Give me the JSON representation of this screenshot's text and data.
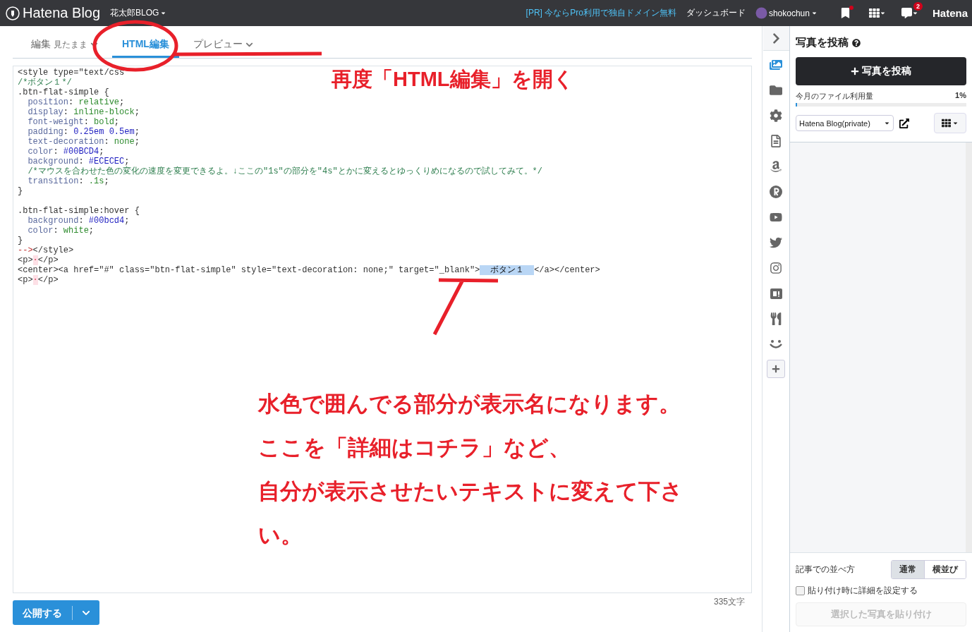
{
  "header": {
    "logo": "Hatena Blog",
    "blog_name": "花太郎BLOG",
    "promo": "[PR] 今ならPro利用で独自ドメイン無料",
    "dashboard": "ダッシュボード",
    "user": "shokochun",
    "notification_count": "2",
    "brand": "Hatena"
  },
  "editor_tabs": [
    {
      "label": "編集",
      "sublabel": "見たまま",
      "selected": false,
      "has_menu": true
    },
    {
      "label": "HTML編集",
      "selected": true,
      "has_menu": false
    },
    {
      "label": "プレビュー",
      "selected": false,
      "has_menu": true
    }
  ],
  "code_lines": [
    {
      "segments": [
        {
          "kind": "tag",
          "text": "<style type=\"text/css"
        }
      ]
    },
    {
      "segments": [
        {
          "kind": "comment",
          "text": "/*ボタン１*/"
        }
      ]
    },
    {
      "segments": [
        {
          "kind": "plain",
          "text": ".btn-flat-simple {"
        }
      ]
    },
    {
      "segments": [
        {
          "kind": "prop",
          "text": "  position"
        },
        {
          "kind": "plain",
          "text": ": "
        },
        {
          "kind": "value",
          "text": "relative"
        },
        {
          "kind": "plain",
          "text": ";"
        }
      ]
    },
    {
      "segments": [
        {
          "kind": "prop",
          "text": "  display"
        },
        {
          "kind": "plain",
          "text": ": "
        },
        {
          "kind": "value",
          "text": "inline-block"
        },
        {
          "kind": "plain",
          "text": ";"
        }
      ]
    },
    {
      "segments": [
        {
          "kind": "prop",
          "text": "  font-weight"
        },
        {
          "kind": "plain",
          "text": ": "
        },
        {
          "kind": "value",
          "text": "bold"
        },
        {
          "kind": "plain",
          "text": ";"
        }
      ]
    },
    {
      "segments": [
        {
          "kind": "prop",
          "text": "  padding"
        },
        {
          "kind": "plain",
          "text": ": "
        },
        {
          "kind": "number",
          "text": "0.25em 0.5em"
        },
        {
          "kind": "plain",
          "text": ";"
        }
      ]
    },
    {
      "segments": [
        {
          "kind": "prop",
          "text": "  text-decoration"
        },
        {
          "kind": "plain",
          "text": ": "
        },
        {
          "kind": "value",
          "text": "none"
        },
        {
          "kind": "plain",
          "text": ";"
        }
      ]
    },
    {
      "segments": [
        {
          "kind": "prop",
          "text": "  color"
        },
        {
          "kind": "plain",
          "text": ": "
        },
        {
          "kind": "number",
          "text": "#00BCD4"
        },
        {
          "kind": "plain",
          "text": ";"
        }
      ]
    },
    {
      "segments": [
        {
          "kind": "prop",
          "text": "  background"
        },
        {
          "kind": "plain",
          "text": ": "
        },
        {
          "kind": "number",
          "text": "#ECECEC"
        },
        {
          "kind": "plain",
          "text": ";"
        }
      ]
    },
    {
      "segments": [
        {
          "kind": "comment",
          "text": "  /*マウスを合わせた色の変化の速度を変更できるよ。↓ここの\"1s\"の部分を\"4s\"とかに変えるとゆっくりめになるので試してみて。*/"
        }
      ]
    },
    {
      "segments": [
        {
          "kind": "prop",
          "text": "  transition"
        },
        {
          "kind": "plain",
          "text": ": "
        },
        {
          "kind": "value",
          "text": ".1s"
        },
        {
          "kind": "plain",
          "text": ";"
        }
      ]
    },
    {
      "segments": [
        {
          "kind": "plain",
          "text": "}"
        }
      ]
    },
    {
      "kind": "blank"
    },
    {
      "segments": [
        {
          "kind": "plain",
          "text": ".btn-flat-simple:hover {"
        }
      ]
    },
    {
      "segments": [
        {
          "kind": "prop",
          "text": "  background"
        },
        {
          "kind": "plain",
          "text": ": "
        },
        {
          "kind": "number",
          "text": "#00bcd4"
        },
        {
          "kind": "plain",
          "text": ";"
        }
      ]
    },
    {
      "segments": [
        {
          "kind": "prop",
          "text": "  color"
        },
        {
          "kind": "plain",
          "text": ": "
        },
        {
          "kind": "value",
          "text": "white"
        },
        {
          "kind": "plain",
          "text": ";"
        }
      ]
    },
    {
      "segments": [
        {
          "kind": "plain",
          "text": "}"
        }
      ]
    },
    {
      "segments": [
        {
          "kind": "marker",
          "text": "-->"
        },
        {
          "kind": "tag",
          "text": "</style>"
        }
      ]
    },
    {
      "segments": [
        {
          "kind": "tag",
          "text": "<p>"
        },
        {
          "kind": "special",
          "text": "·"
        },
        {
          "kind": "tag",
          "text": "</p>"
        }
      ]
    },
    {
      "segments": [
        {
          "kind": "tag",
          "text": "<center><a href=\"#\" class=\"btn-flat-simple\" style=\"text-decoration: none;\" target=\"_blank\">"
        },
        {
          "kind": "selected",
          "text": "  ボタン１  "
        },
        {
          "kind": "tag",
          "text": "</a></center>"
        }
      ]
    },
    {
      "segments": [
        {
          "kind": "tag",
          "text": "<p>"
        },
        {
          "kind": "special",
          "text": "·"
        },
        {
          "kind": "tag",
          "text": "</p>"
        }
      ]
    }
  ],
  "footer": {
    "publish": "公開する",
    "char_count": "335文字"
  },
  "photo_panel": {
    "title": "写真を投稿",
    "upload": "写真を投稿",
    "usage_label": "今月のファイル利用量",
    "usage_reading": "1%",
    "usage": {
      "level": 0.01
    },
    "album": "Hatena Blog(private)",
    "order_label": "記事での並べ方",
    "order_options": [
      {
        "label": "通常",
        "selected": true
      },
      {
        "label": "横並び",
        "selected": false
      }
    ],
    "detail_checkbox": {
      "label": "貼り付け時に詳細を設定する",
      "checked": false
    },
    "paste": "選択した写真を貼り付け"
  },
  "annotations": {
    "tab_callout": "再度「HTML編集」を開く",
    "note_lines": [
      "水色で囲んでる部分が表示名になります。",
      "ここを「詳細はコチラ」など、",
      "自分が表示させたいテキストに変えて下さ",
      "い。"
    ]
  }
}
